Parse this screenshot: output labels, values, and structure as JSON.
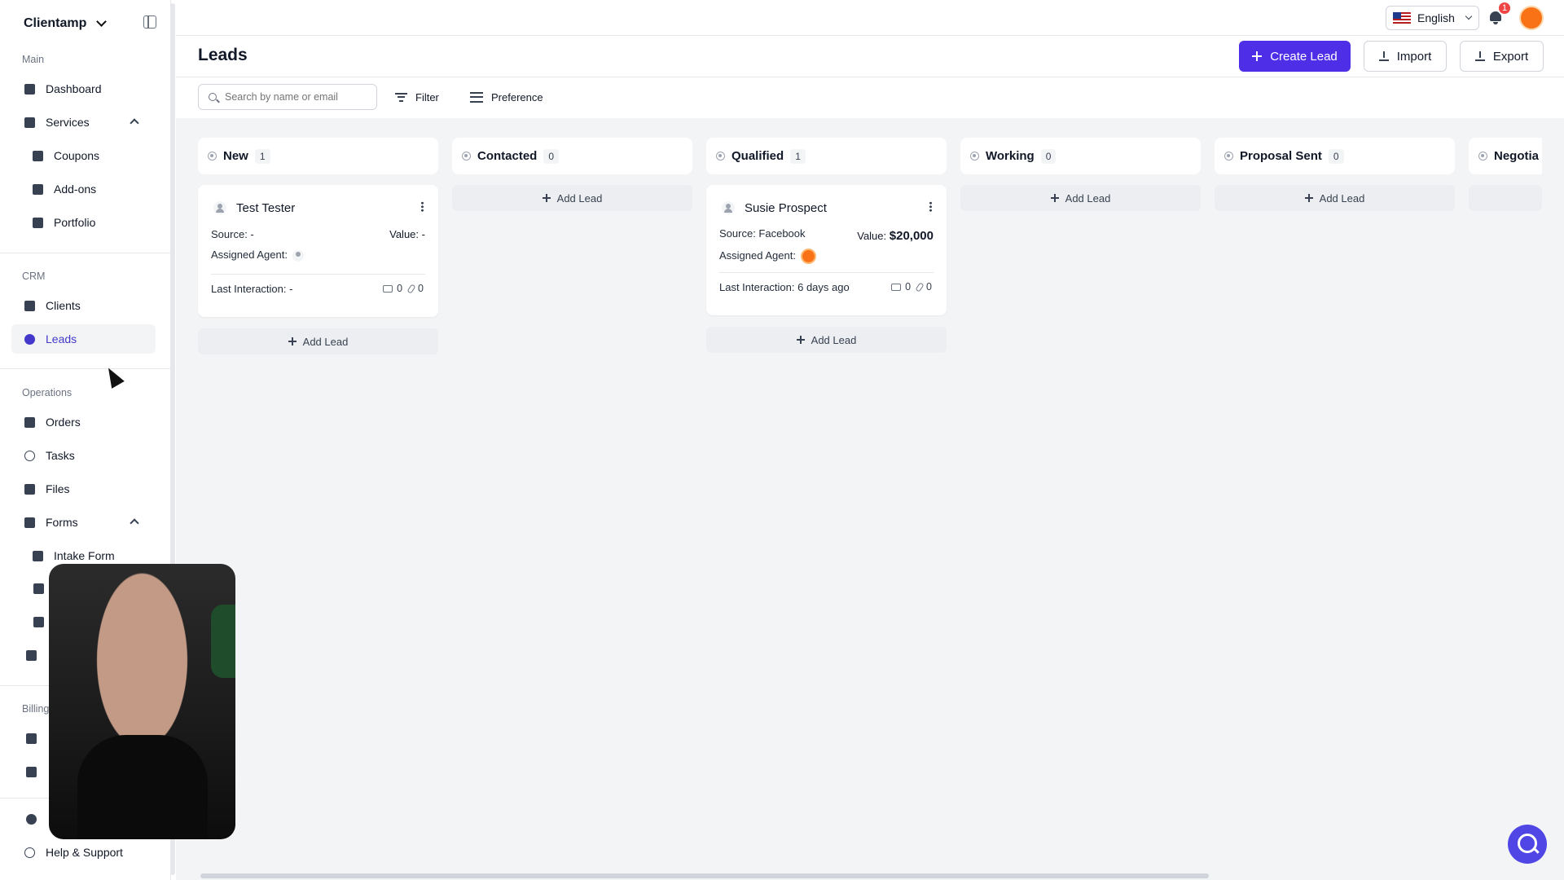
{
  "sidebar": {
    "brand": "Clientamp",
    "sections": {
      "main": "Main",
      "crm": "CRM",
      "operations": "Operations",
      "billing": "Billing"
    },
    "items": {
      "dashboard": "Dashboard",
      "services": "Services",
      "coupons": "Coupons",
      "addons": "Add-ons",
      "portfolio": "Portfolio",
      "clients": "Clients",
      "leads": "Leads",
      "orders": "Orders",
      "tasks": "Tasks",
      "files": "Files",
      "forms": "Forms",
      "intake_form": "Intake Form",
      "help": "Help & Support"
    }
  },
  "topbar": {
    "language": "English",
    "notification_count": "1"
  },
  "page": {
    "title": "Leads",
    "create_label": "Create Lead",
    "import_label": "Import",
    "export_label": "Export",
    "search_placeholder": "Search by name or email",
    "filter_label": "Filter",
    "preference_label": "Preference"
  },
  "board": {
    "add_lead_label": "Add Lead",
    "columns": [
      {
        "name": "New",
        "count": "1"
      },
      {
        "name": "Contacted",
        "count": "0"
      },
      {
        "name": "Qualified",
        "count": "1"
      },
      {
        "name": "Working",
        "count": "0"
      },
      {
        "name": "Proposal Sent",
        "count": "0"
      },
      {
        "name": "Negotia",
        "count": ""
      }
    ],
    "cards": [
      {
        "name": "Test Tester",
        "source": "Source: -",
        "value_label": "Value:",
        "value": "-",
        "agent_label": "Assigned Agent:",
        "last_interaction": "Last Interaction: -",
        "files": "0",
        "attachments": "0"
      },
      {
        "name": "Susie Prospect",
        "source": "Source: Facebook",
        "value_label": "Value:",
        "value": "$20,000",
        "agent_label": "Assigned Agent:",
        "last_interaction": "Last Interaction: 6 days ago",
        "files": "0",
        "attachments": "0"
      }
    ]
  },
  "colors": {
    "primary": "#4f2ee8",
    "active_nav": "#4338ca",
    "board_bg": "#f3f4f6",
    "badge": "#ef4444",
    "avatar": "#f97316"
  }
}
